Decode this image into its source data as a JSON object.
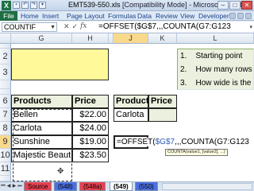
{
  "window": {
    "title_prefix": "EMT539-550.xls",
    "title_suffix": " [Compatibility Mode] - Microsoft Excel",
    "app_letter": "X"
  },
  "ribbon": {
    "tabs": [
      "File",
      "Home",
      "Insert",
      "Page Layout",
      "Formulas",
      "Data",
      "Review",
      "View",
      "Developer"
    ]
  },
  "formula_bar": {
    "name_box": "COUNTIF",
    "cancel": "✕",
    "enter": "✓",
    "fx": "fx",
    "formula": "=OFFSET($G$7,,,COUNTA(G7:G123"
  },
  "columns": [
    "G",
    "H",
    "I",
    "J",
    "K",
    "L"
  ],
  "rows": [
    "1",
    "2",
    "3",
    "4",
    "5",
    "6",
    "7",
    "8",
    "9",
    "10",
    "11",
    "12"
  ],
  "products_table": {
    "header": [
      "Products",
      "Price"
    ],
    "rows": [
      [
        "Bellen",
        "$22.00"
      ],
      [
        "Carlota",
        "$24.00"
      ],
      [
        "Sunshine",
        "$19.00"
      ],
      [
        "Majestic Beaut",
        "$23.50"
      ]
    ]
  },
  "lookup_table": {
    "header": [
      "Products",
      "Price"
    ],
    "product": "Carlota"
  },
  "edit_cell": {
    "prefix": "=OFFSET(",
    "ref": "$G$7",
    "suffix": ",,,COUNTA(G7:G123"
  },
  "tooltip": "COUNTA(value1, [value2], ...)",
  "notes": [
    {
      "num": "1.",
      "text": "Starting point"
    },
    {
      "num": "2.",
      "text": "How many rows"
    },
    {
      "num": "3.",
      "text": "How wide is the"
    }
  ],
  "sheet_tabs": [
    {
      "label": "Source",
      "color": "#e8414f"
    },
    {
      "label": "(548)",
      "color": "#4c6fe0"
    },
    {
      "label": "(548a)",
      "color": "#e8414f"
    },
    {
      "label": "(549)",
      "color": "#ffffff"
    },
    {
      "label": "(550)",
      "color": "#4c6fe0"
    }
  ]
}
